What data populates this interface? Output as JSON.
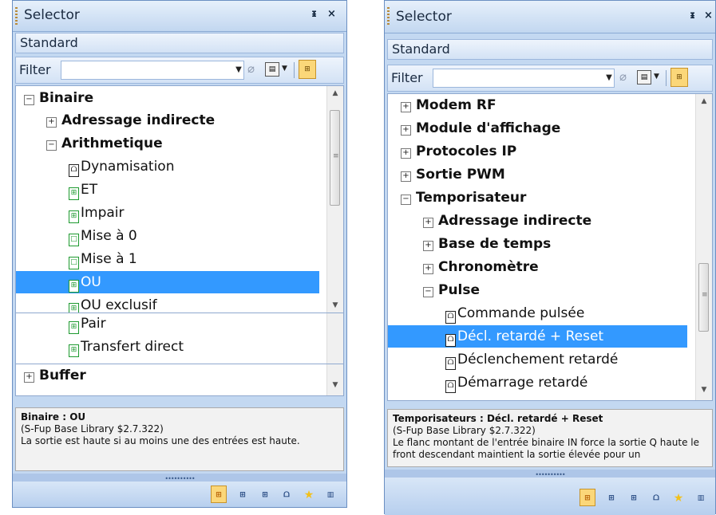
{
  "panels": [
    {
      "title": "Selector",
      "pin_icon": "pin-icon",
      "close_label": "×",
      "standard_label": "Standard",
      "filter_label": "Filter",
      "filter_value": "",
      "tree": [
        {
          "label": "Binaire",
          "bold": true,
          "expander": "⊟"
        },
        {
          "label": "Adressage indirecte",
          "bold": true,
          "expander": "⊞"
        },
        {
          "label": "Arithmetique",
          "bold": true,
          "expander": "⊟"
        },
        {
          "label": "Dynamisation",
          "bold": false,
          "icon": "block-icon"
        },
        {
          "label": "ET",
          "bold": false,
          "icon": "block-green-icon"
        },
        {
          "label": "Impair",
          "bold": false,
          "icon": "block-green-icon"
        },
        {
          "label": "Mise à 0",
          "bold": false,
          "icon": "block-green-outline-icon"
        },
        {
          "label": "Mise à 1",
          "bold": false,
          "icon": "block-green-outline-icon"
        },
        {
          "label": "OU",
          "bold": false,
          "icon": "block-green-icon",
          "selected": true
        },
        {
          "label": "OU exclusif",
          "bold": false,
          "icon": "block-green-icon"
        },
        {
          "label": "Pair",
          "bold": false,
          "icon": "block-green-icon"
        },
        {
          "label": "Transfert direct",
          "bold": false,
          "icon": "block-green-icon"
        },
        {
          "label": "Buffer",
          "bold": true,
          "expander": "⊞"
        }
      ],
      "info": {
        "title": "Binaire : OU",
        "library": "(S-Fup Base Library $2.7.322)",
        "description": "La sortie est haute si au moins une des entrées est haute."
      }
    },
    {
      "title": "Selector",
      "pin_icon": "pin-icon",
      "close_label": "×",
      "standard_label": "Standard",
      "filter_label": "Filter",
      "filter_value": "",
      "tree": [
        {
          "label": "Modem RF",
          "bold": true,
          "expander": "⊞"
        },
        {
          "label": "Module d'affichage",
          "bold": true,
          "expander": "⊞"
        },
        {
          "label": "Protocoles IP",
          "bold": true,
          "expander": "⊞"
        },
        {
          "label": "Sortie PWM",
          "bold": true,
          "expander": "⊞"
        },
        {
          "label": "Temporisateur",
          "bold": true,
          "expander": "⊟"
        },
        {
          "label": "Adressage indirecte",
          "bold": true,
          "expander": "⊞"
        },
        {
          "label": "Base de temps",
          "bold": true,
          "expander": "⊞"
        },
        {
          "label": "Chronomètre",
          "bold": true,
          "expander": "⊞"
        },
        {
          "label": "Pulse",
          "bold": true,
          "expander": "⊟"
        },
        {
          "label": "Commande pulsée",
          "bold": false,
          "icon": "block-icon"
        },
        {
          "label": "Décl. retardé + Reset",
          "bold": false,
          "icon": "block-icon",
          "selected": true
        },
        {
          "label": "Déclenchement retardé",
          "bold": false,
          "icon": "block-icon"
        },
        {
          "label": "Démarrage retardé",
          "bold": false,
          "icon": "block-icon"
        }
      ],
      "info": {
        "title": "Temporisateurs : Décl. retardé + Reset",
        "library": "(S-Fup Base Library $2.7.322)",
        "description": "Le flanc montant de l'entrée binaire IN force la sortie Q haute le front descendant maintient la sortie élevée pour un"
      }
    }
  ],
  "bottom_icons": [
    "fbox-a-icon",
    "fbox-b-icon",
    "fbox-c-icon",
    "fbox-d-icon",
    "favorites-star-icon",
    "library-icon"
  ],
  "colors": {
    "selection": "#3399ff",
    "panel_bg": "#c3d8f1",
    "accent_button": "#fbd779"
  }
}
